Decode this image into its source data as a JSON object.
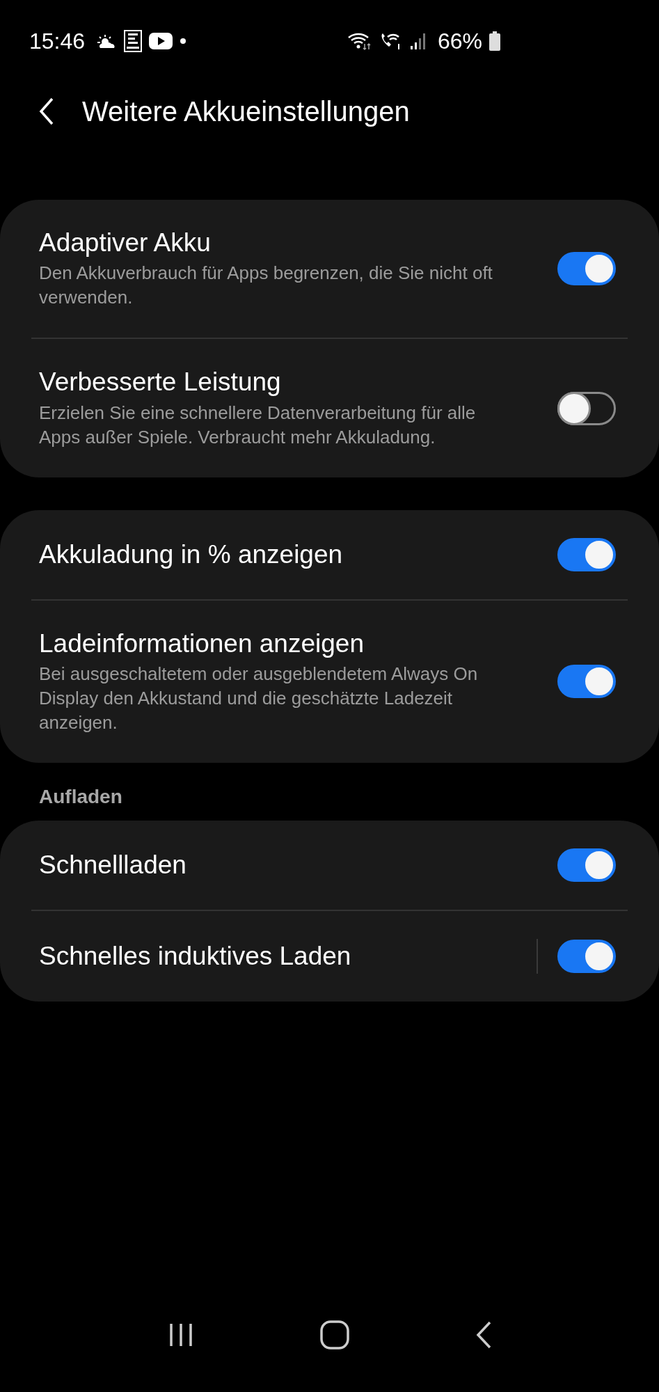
{
  "status_bar": {
    "time": "15:46",
    "battery": "66%"
  },
  "header": {
    "title": "Weitere Akkueinstellungen"
  },
  "groups": [
    {
      "rows": [
        {
          "title": "Adaptiver Akku",
          "subtitle": "Den Akkuverbrauch für Apps begrenzen, die Sie nicht oft verwenden.",
          "on": true,
          "split": false
        },
        {
          "title": "Verbesserte Leistung",
          "subtitle": "Erzielen Sie eine schnellere Datenverarbeitung für alle Apps außer Spiele. Verbraucht mehr Akkuladung.",
          "on": false,
          "split": false
        }
      ]
    },
    {
      "rows": [
        {
          "title": "Akkuladung in % anzeigen",
          "on": true,
          "split": false
        },
        {
          "title": "Ladeinformationen anzeigen",
          "subtitle": "Bei ausgeschaltetem oder ausgeblendetem Always On Display den Akkustand und die geschätzte Ladezeit anzeigen.",
          "on": true,
          "split": false
        }
      ]
    },
    {
      "heading": "Aufladen",
      "rows": [
        {
          "title": "Schnellladen",
          "on": true,
          "split": false
        },
        {
          "title": "Schnelles induktives Laden",
          "on": true,
          "split": true
        }
      ]
    }
  ]
}
